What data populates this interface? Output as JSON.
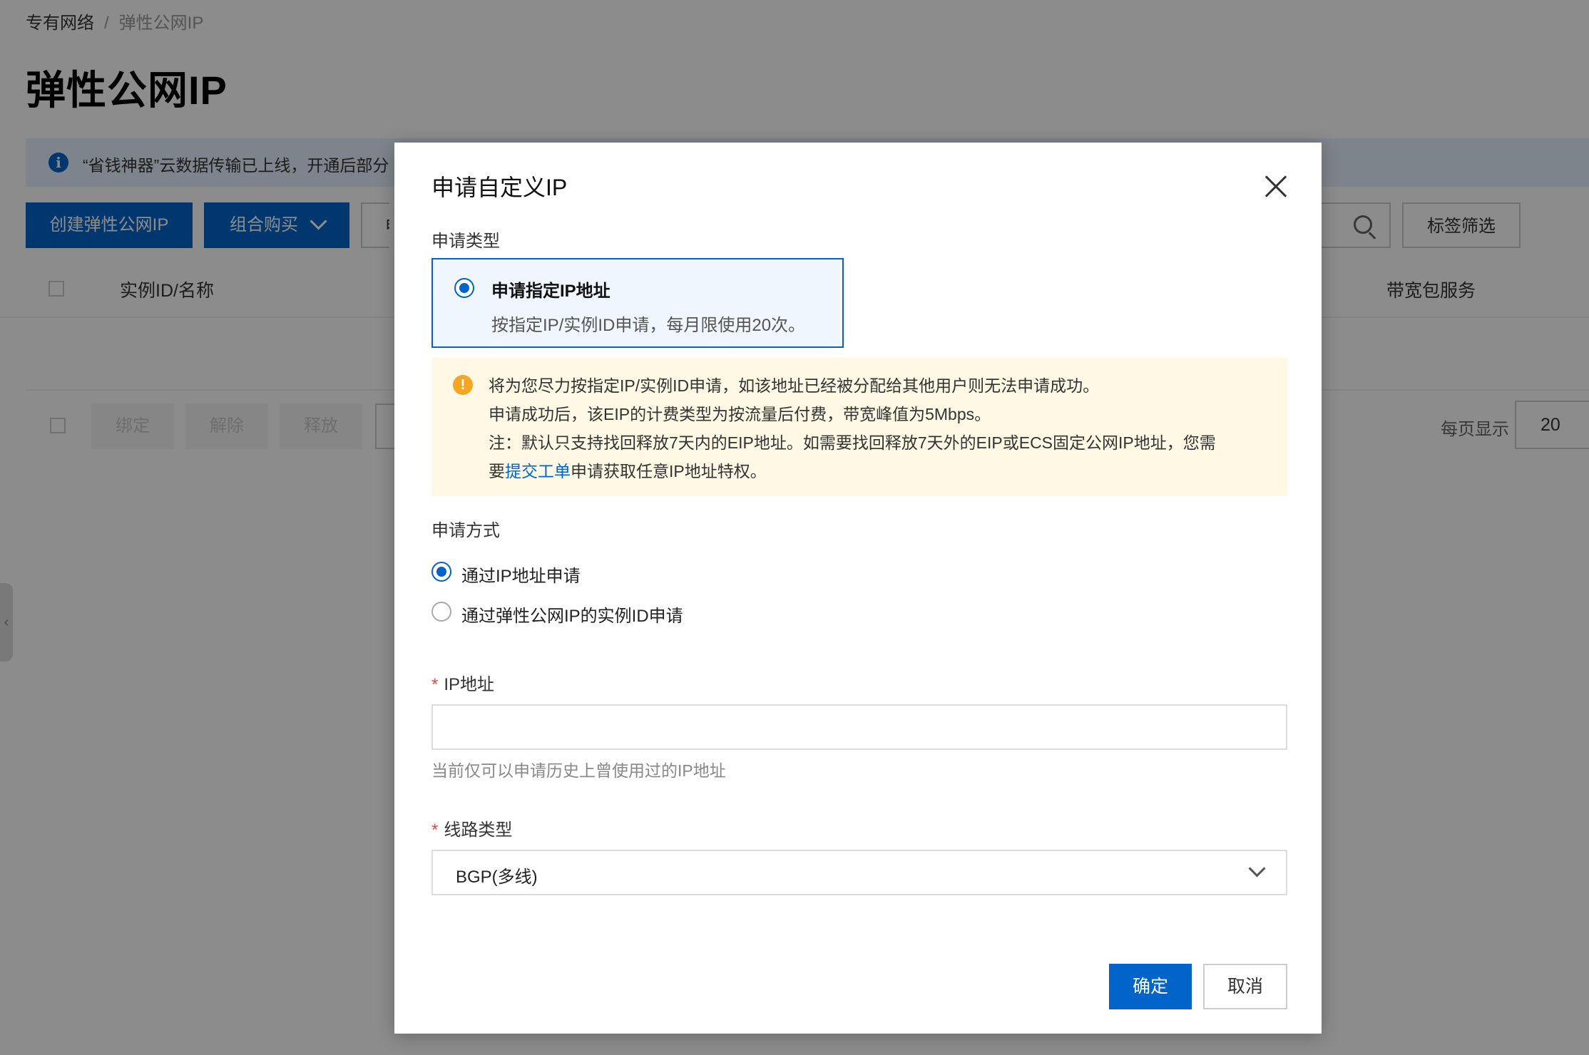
{
  "breadcrumb": {
    "parent": "专有网络",
    "separator": "/",
    "current": "弹性公网IP"
  },
  "page": {
    "title": "弹性公网IP"
  },
  "notice": {
    "icon": "info-icon",
    "text": "“省钱神器”云数据传输已上线，开通后部分"
  },
  "toolbar": {
    "create_label": "创建弹性公网IP",
    "combo_label": "组合购买",
    "apply_stub": "申",
    "tag_filter_label": "标签筛选"
  },
  "table": {
    "col_instance": "实例ID/名称",
    "col_bandwidth": "带宽包服务"
  },
  "batch": {
    "bind": "绑定",
    "unbind": "解除",
    "release": "释放"
  },
  "pagination": {
    "per_page_label": "每页显示",
    "per_page_value": "20"
  },
  "side_tab": {
    "glyph": "‹"
  },
  "dialog": {
    "title": "申请自定义IP",
    "apply_type_label": "申请类型",
    "type_card": {
      "title": "申请指定IP地址",
      "desc": "按指定IP/实例ID申请，每月限使用20次。",
      "selected": true
    },
    "warning": {
      "line1": "将为您尽力按指定IP/实例ID申请，如该地址已经被分配给其他用户则无法申请成功。",
      "line2": "申请成功后，该EIP的计费类型为按流量后付费，带宽峰值为5Mbps。",
      "line3": "注：默认只支持找回释放7天内的EIP地址。如需要找回释放7天外的EIP或ECS固定公网IP地址，您需",
      "line4_prefix": "要",
      "line4_link": "提交工单",
      "line4_suffix": "申请获取任意IP地址特权。"
    },
    "method_label": "申请方式",
    "method_options": [
      {
        "label": "通过IP地址申请",
        "selected": true
      },
      {
        "label": "通过弹性公网IP的实例ID申请",
        "selected": false
      }
    ],
    "ip_label": "IP地址",
    "required_mark": "*",
    "ip_value": "",
    "ip_hint": "当前仅可以申请历史上曾使用过的IP地址",
    "line_type_label": "线路类型",
    "line_type_value": "BGP(多线)",
    "ok_label": "确定",
    "cancel_label": "取消"
  },
  "colors": {
    "primary": "#0064c8",
    "warning_bg": "#fff8e5",
    "warning_icon": "#f5a623",
    "required": "#e84738"
  }
}
